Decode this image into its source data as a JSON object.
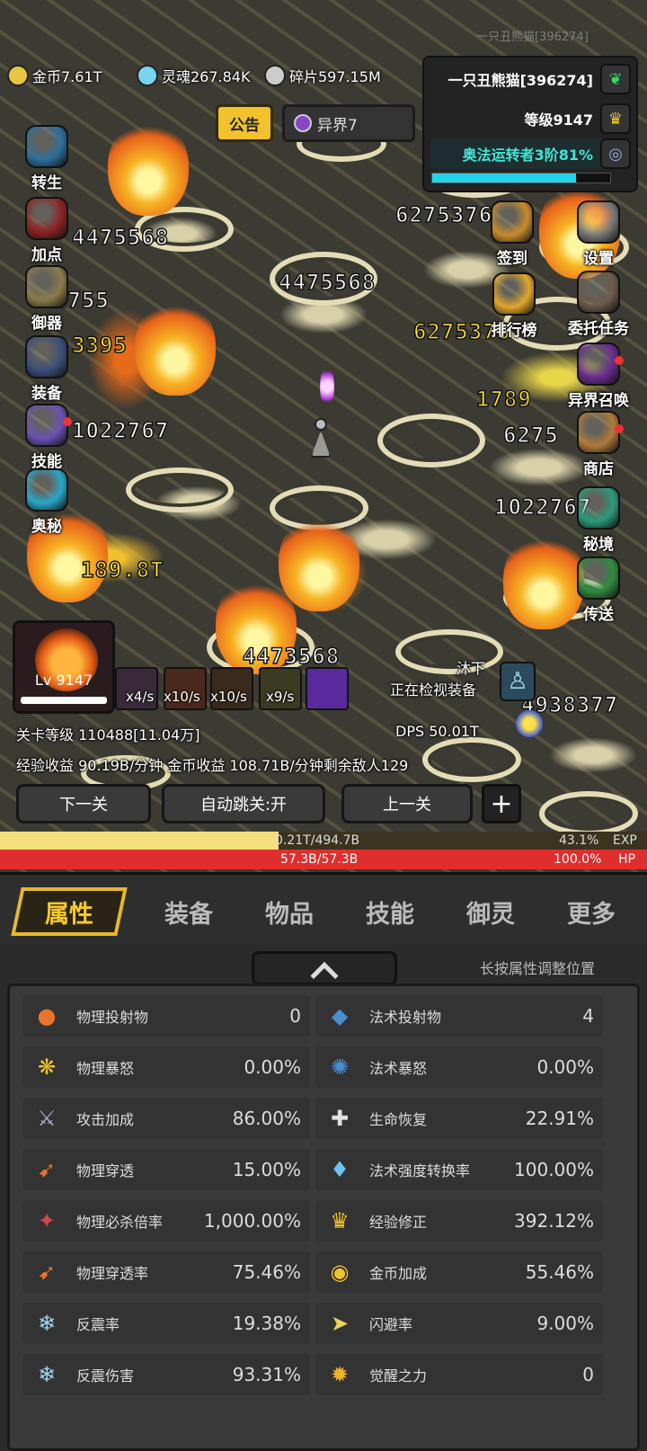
{
  "watermark": "一只丑熊猫[396274]",
  "resources": [
    {
      "icon": "gold-coin-icon",
      "label": "金币7.61T",
      "color": "#e8c542"
    },
    {
      "icon": "soul-icon",
      "label": "灵魂267.84K",
      "color": "#7ad3f0"
    },
    {
      "icon": "shard-icon",
      "label": "碎片597.15M",
      "color": "#cccccc"
    }
  ],
  "player": {
    "name": "一只丑熊猫[396274]",
    "level_text": "等级9147",
    "class_text": "奥法运转者3阶81%",
    "class_progress": 0.81
  },
  "notice_label": "公告",
  "realm_label": "异界7",
  "left_menu": [
    {
      "id": "rebirth",
      "label": "转生",
      "color": "#2c6e9e"
    },
    {
      "id": "add-points",
      "label": "加点",
      "color": "#8e2323"
    },
    {
      "id": "spirit",
      "label": "御器",
      "color": "#8c7b4a"
    },
    {
      "id": "equipment",
      "label": "装备",
      "color": "#3b4f7a"
    },
    {
      "id": "skills",
      "label": "技能",
      "color": "#6a52b3"
    },
    {
      "id": "arcane",
      "label": "奥秘",
      "color": "#2aa6c9"
    }
  ],
  "right_menu": [
    {
      "id": "checkin",
      "label": "签到",
      "color": "#c98b2d"
    },
    {
      "id": "settings",
      "label": "设置",
      "color": "#777777"
    },
    {
      "id": "ranking",
      "label": "排行榜",
      "color": "#e3a52c"
    },
    {
      "id": "commission",
      "label": "委托任务",
      "color": "#6b5a4a"
    },
    {
      "id": "summon",
      "label": "异界召唤",
      "color": "#6a2c8f"
    },
    {
      "id": "shop",
      "label": "商店",
      "color": "#b07a3a"
    },
    {
      "id": "secret-realm",
      "label": "秘境",
      "color": "#2b9a7a"
    },
    {
      "id": "teleport",
      "label": "传送",
      "color": "#2e8a3d"
    }
  ],
  "damage_numbers": [
    "4475568",
    "1022767",
    "189.8T",
    "1789",
    "6275376",
    "2755",
    "3395",
    "6275",
    "4475568",
    "1022767",
    "4938377",
    "4473568",
    "6275376"
  ],
  "hero": {
    "level": "Lv 9147"
  },
  "skills": [
    {
      "rate": "x4/s",
      "color": "#3a2a3c"
    },
    {
      "rate": "x10/s",
      "color": "#4a2a1c"
    },
    {
      "rate": "x10/s",
      "color": "#3a2a1c"
    },
    {
      "rate": "x9/s",
      "color": "#3b3a22"
    },
    {
      "rate": "",
      "color": "#5a2a9c"
    }
  ],
  "status": {
    "name": "沐下",
    "text": "正在检视装备"
  },
  "stage": {
    "level": "关卡等级 110488[11.04万]",
    "dps": "DPS  50.01T",
    "income": "经验收益 90.19B/分钟  金币收益 108.71B/分钟剩余敌人129"
  },
  "buttons": {
    "next": "下一关",
    "auto": "自动跳关:开",
    "prev": "上一关",
    "plus": "+"
  },
  "exp": {
    "text": "0.21T/494.7B",
    "percent": "43.1%",
    "label": "EXP",
    "fill": 0.43
  },
  "hp": {
    "text": "57.3B/57.3B",
    "percent": "100.0%",
    "label": "HP",
    "fill": 1.0
  },
  "tabs": [
    "属性",
    "装备",
    "物品",
    "技能",
    "御灵",
    "更多"
  ],
  "hint": "长按属性调整位置",
  "attributes": [
    {
      "icon": "physical-projectile-icon",
      "glyph": "●",
      "color": "#e8762a",
      "name": "物理投射物",
      "value": "0"
    },
    {
      "icon": "spell-projectile-icon",
      "glyph": "◆",
      "color": "#4a8fd1",
      "name": "法术投射物",
      "value": "4"
    },
    {
      "icon": "physical-rage-icon",
      "glyph": "❋",
      "color": "#f0c32a",
      "name": "物理暴怒",
      "value": "0.00%"
    },
    {
      "icon": "spell-rage-icon",
      "glyph": "✺",
      "color": "#4a8fd1",
      "name": "法术暴怒",
      "value": "0.00%"
    },
    {
      "icon": "attack-bonus-icon",
      "glyph": "⚔",
      "color": "#b9a8d9",
      "name": "攻击加成",
      "value": "86.00%"
    },
    {
      "icon": "life-regen-icon",
      "glyph": "✚",
      "color": "#e0e0e0",
      "name": "生命恢复",
      "value": "22.91%"
    },
    {
      "icon": "physical-penetration-icon",
      "glyph": "➹",
      "color": "#e8762a",
      "name": "物理穿透",
      "value": "15.00%"
    },
    {
      "icon": "spell-power-conversion-icon",
      "glyph": "♦",
      "color": "#6cc4f0",
      "name": "法术强度转换率",
      "value": "100.00%"
    },
    {
      "icon": "physical-crit-multiplier-icon",
      "glyph": "✦",
      "color": "#d14a4a",
      "name": "物理必杀倍率",
      "value": "1,000.00%"
    },
    {
      "icon": "exp-modifier-icon",
      "glyph": "♛",
      "color": "#f0c32a",
      "name": "经验修正",
      "value": "392.12%"
    },
    {
      "icon": "physical-penetration-rate-icon",
      "glyph": "➹",
      "color": "#e8762a",
      "name": "物理穿透率",
      "value": "75.46%"
    },
    {
      "icon": "gold-bonus-icon",
      "glyph": "◉",
      "color": "#f0c32a",
      "name": "金币加成",
      "value": "55.46%"
    },
    {
      "icon": "reflect-rate-icon",
      "glyph": "❄",
      "color": "#9fd4f0",
      "name": "反震率",
      "value": "19.38%"
    },
    {
      "icon": "dodge-rate-icon",
      "glyph": "➤",
      "color": "#f0d45a",
      "name": "闪避率",
      "value": "9.00%"
    },
    {
      "icon": "reflect-damage-icon",
      "glyph": "❄",
      "color": "#9fd4f0",
      "name": "反震伤害",
      "value": "93.31%"
    },
    {
      "icon": "awakening-icon",
      "glyph": "✹",
      "color": "#f0b42a",
      "name": "觉醒之力",
      "value": "0"
    }
  ]
}
